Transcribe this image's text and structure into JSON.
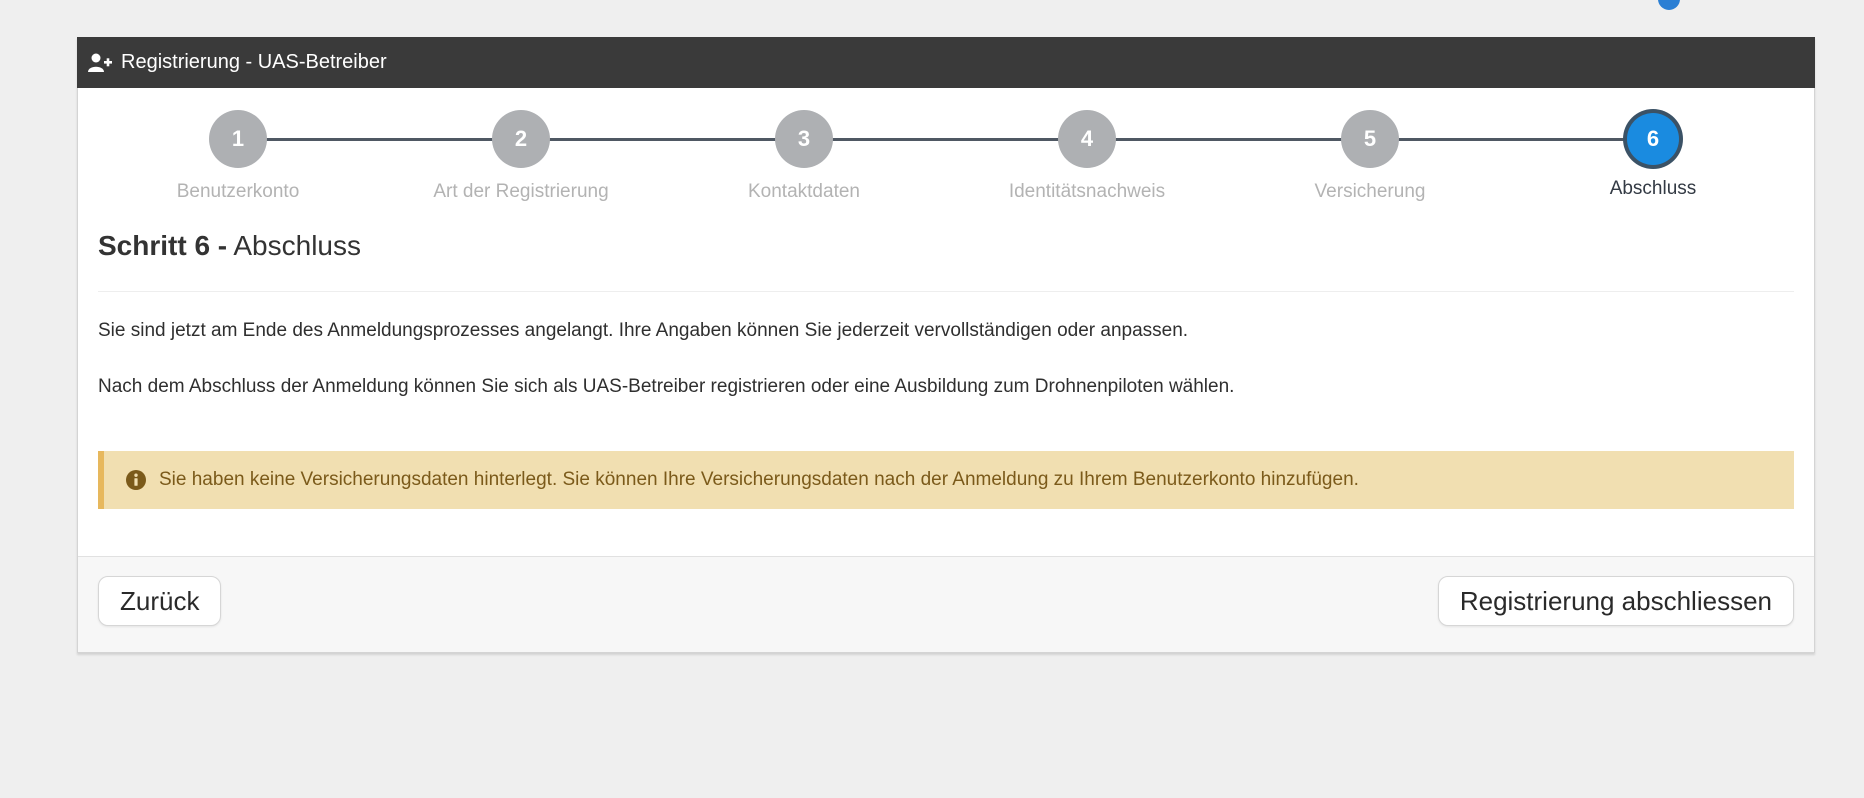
{
  "header": {
    "title": "Registrierung - UAS-Betreiber",
    "icon": "user-plus-icon"
  },
  "stepper": {
    "steps": [
      {
        "number": "1",
        "label": "Benutzerkonto",
        "state": "inactive"
      },
      {
        "number": "2",
        "label": "Art der Registrierung",
        "state": "inactive"
      },
      {
        "number": "3",
        "label": "Kontaktdaten",
        "state": "inactive"
      },
      {
        "number": "4",
        "label": "Identitätsnachweis",
        "state": "inactive"
      },
      {
        "number": "5",
        "label": "Versicherung",
        "state": "inactive"
      },
      {
        "number": "6",
        "label": "Abschluss",
        "state": "active"
      }
    ],
    "active_color": "#1a8be0",
    "inactive_color": "#aeb0b3"
  },
  "main": {
    "title_strong": "Schritt 6 -",
    "title_rest": "Abschluss",
    "paragraphs": [
      "Sie sind jetzt am Ende des Anmeldungsprozesses angelangt. Ihre Angaben können Sie jederzeit vervollständigen oder anpassen.",
      "Nach dem Abschluss der Anmeldung können Sie sich als UAS-Betreiber registrieren oder eine Ausbildung zum Drohnenpiloten wählen."
    ],
    "alert": {
      "icon": "info-circle-icon",
      "text": "Sie haben keine Versicherungsdaten hinterlegt. Sie können Ihre Versicherungsdaten nach der Anmeldung zu Ihrem Benutzerkonto hinzufügen.",
      "background": "#f1dfb1",
      "border": "#e7b85d",
      "text_color": "#7b5a1a"
    }
  },
  "footer": {
    "back_label": "Zurück",
    "finish_label": "Registrierung abschliessen"
  },
  "colors": {
    "header_bg": "#3a3a3a",
    "page_bg": "#efefef"
  }
}
